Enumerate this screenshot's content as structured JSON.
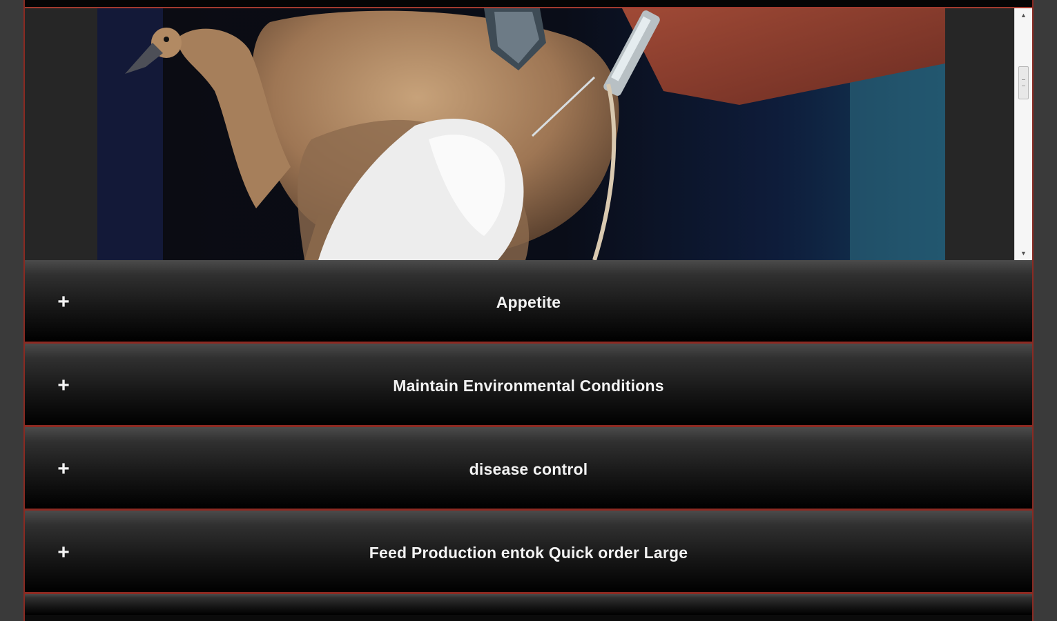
{
  "image": {
    "alt": "duck being vaccinated",
    "icon": "duck-photo"
  },
  "scrollbar": {
    "up_icon": "▲",
    "down_icon": "▼",
    "position": 0.3
  },
  "accordion": {
    "items": [
      {
        "label": "Appetite",
        "icon": "+"
      },
      {
        "label": "Maintain Environmental Conditions",
        "icon": "+"
      },
      {
        "label": "disease control",
        "icon": "+"
      },
      {
        "label": "Feed Production entok Quick order Large",
        "icon": "+"
      }
    ]
  },
  "colors": {
    "accent": "#8d2a22",
    "panel": "#0b0b0b",
    "background": "#3a3a3a",
    "text": "#f3f3f3"
  }
}
